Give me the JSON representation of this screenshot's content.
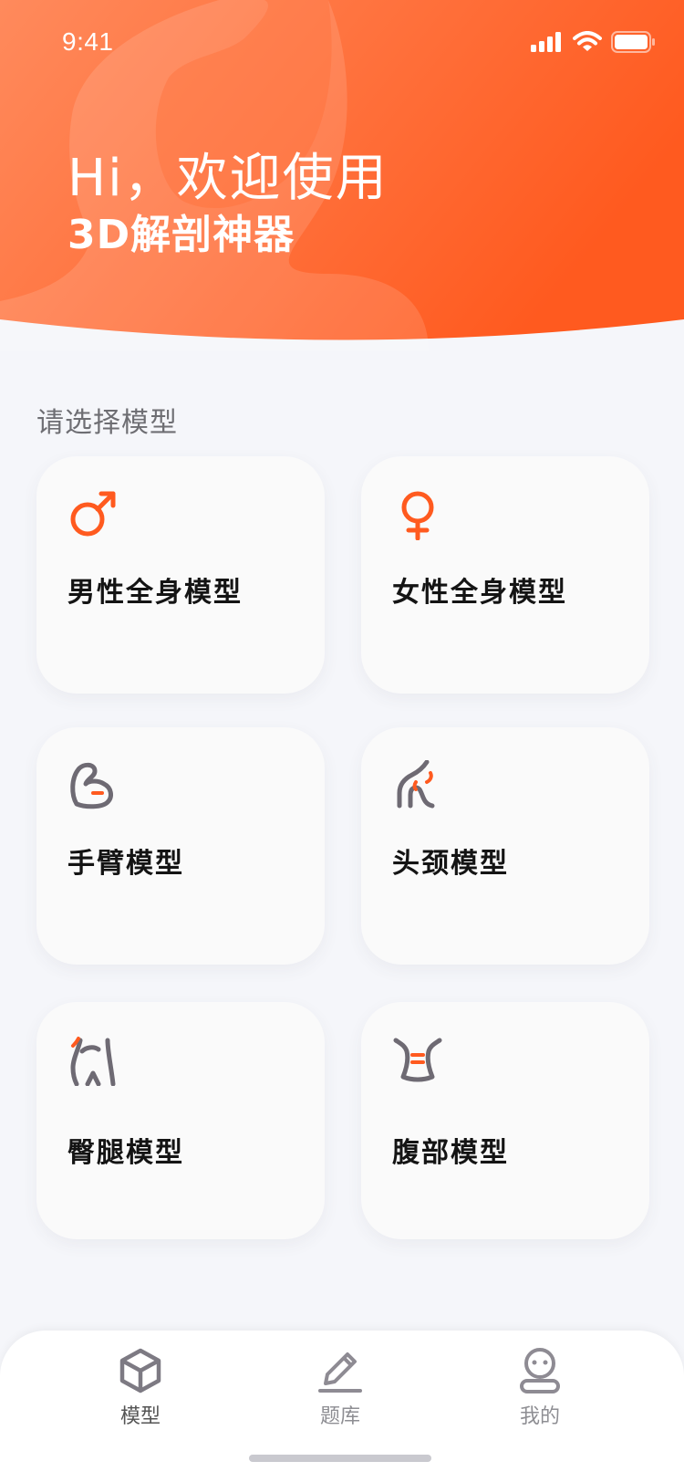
{
  "status_bar": {
    "time": "9:41"
  },
  "header": {
    "greeting": "Hi，欢迎使用",
    "app_name": "3D解剖神器",
    "gradient_start": "#ff8a5c",
    "gradient_end": "#ff5a1f"
  },
  "section": {
    "title": "请选择模型"
  },
  "models": [
    {
      "label": "男性全身模型",
      "icon": "male-symbol-icon"
    },
    {
      "label": "女性全身模型",
      "icon": "female-symbol-icon"
    },
    {
      "label": "手臂模型",
      "icon": "arm-icon"
    },
    {
      "label": "头颈模型",
      "icon": "head-neck-icon"
    },
    {
      "label": "臀腿模型",
      "icon": "hip-leg-icon"
    },
    {
      "label": "腹部模型",
      "icon": "abdomen-icon"
    }
  ],
  "tabbar": {
    "tabs": [
      {
        "label": "模型",
        "icon": "cube-icon",
        "active": true
      },
      {
        "label": "题库",
        "icon": "pencil-icon",
        "active": false
      },
      {
        "label": "我的",
        "icon": "profile-icon",
        "active": false
      }
    ]
  },
  "colors": {
    "accent": "#ff5a1f",
    "icon_gray": "#6e6a73",
    "background": "#f5f6fa"
  }
}
